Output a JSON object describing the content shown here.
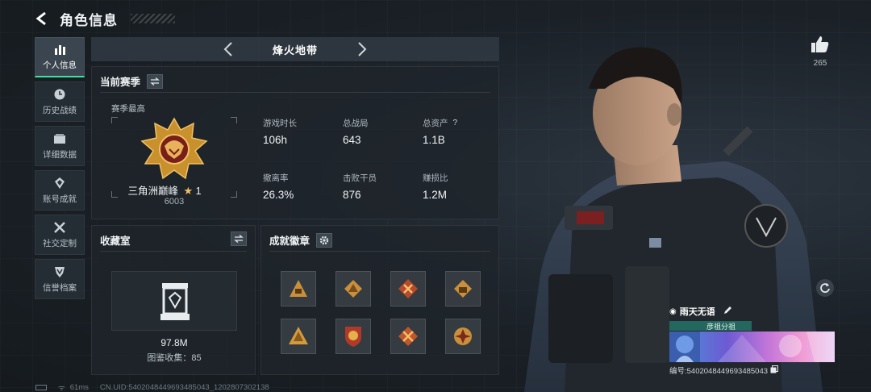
{
  "header": {
    "title": "角色信息"
  },
  "sidebar": {
    "items": [
      {
        "label": "个人信息",
        "icon": "bar-chart-icon",
        "active": true
      },
      {
        "label": "历史战绩",
        "icon": "clock-icon",
        "active": false
      },
      {
        "label": "详细数据",
        "icon": "folder-icon",
        "active": false
      },
      {
        "label": "账号成就",
        "icon": "trophy-icon",
        "active": false
      },
      {
        "label": "社交定制",
        "icon": "wrench-icon",
        "active": false
      },
      {
        "label": "信誉档案",
        "icon": "shield-icon",
        "active": false
      }
    ]
  },
  "mode": {
    "name": "烽火地带"
  },
  "season": {
    "title": "当前赛季",
    "best_label": "赛季最高",
    "rank_name": "三角洲巅峰",
    "rank_stars": "1",
    "rank_score": "6003",
    "stats": [
      {
        "label": "游戏时长",
        "value": "106h"
      },
      {
        "label": "总战局",
        "value": "643"
      },
      {
        "label": "总资产",
        "value": "1.1B",
        "help": "?"
      },
      {
        "label": "撤离率",
        "value": "26.3%"
      },
      {
        "label": "击败干员",
        "value": "876"
      },
      {
        "label": "赚损比",
        "value": "1.2M"
      }
    ]
  },
  "collection": {
    "title": "收藏室",
    "value": "97.8M",
    "count_text": "图鉴收集：85"
  },
  "badges": {
    "title": "成就徽章",
    "items": [
      "badge-1",
      "badge-2",
      "badge-3",
      "badge-4",
      "badge-5",
      "badge-6",
      "badge-7",
      "badge-8"
    ]
  },
  "like": {
    "count": "265"
  },
  "player": {
    "name": "雨天无语",
    "team": "彦祖分祖",
    "id_text": "编号:5402048449693485043"
  },
  "footer": {
    "ping": "61ms",
    "uid": "CN.UID:5402048449693485043_1202807302138"
  },
  "colors": {
    "accent": "#3fe0a0",
    "gold": "#c9902e",
    "team_bar": "#24675f"
  }
}
